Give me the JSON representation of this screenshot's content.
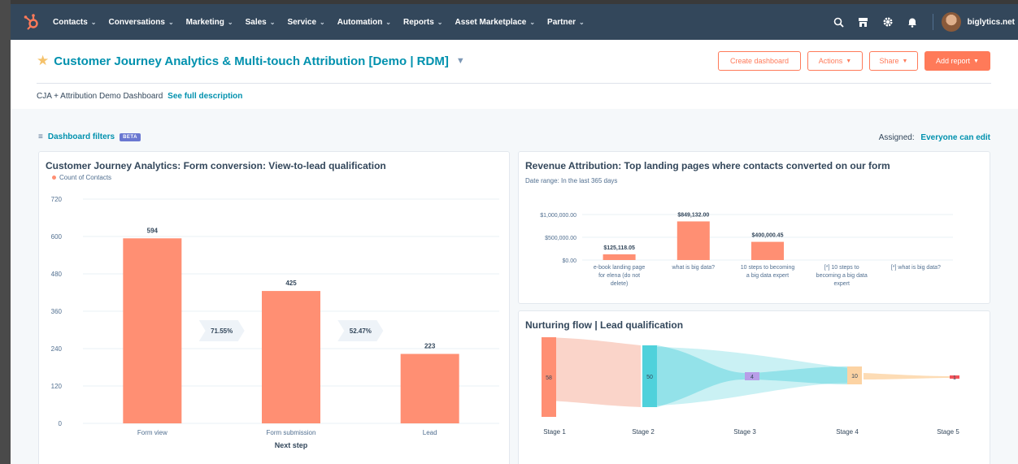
{
  "nav": {
    "items": [
      "Contacts",
      "Conversations",
      "Marketing",
      "Sales",
      "Service",
      "Automation",
      "Reports",
      "Asset Marketplace",
      "Partner"
    ],
    "account": "biglytics.net"
  },
  "header": {
    "title": "Customer Journey Analytics & Multi-touch Attribution [Demo | RDM]",
    "buttons": {
      "create_dashboard": "Create dashboard",
      "actions": "Actions",
      "share": "Share",
      "add_report": "Add report"
    },
    "description": "CJA + Attribution Demo Dashboard",
    "see_full": "See full description"
  },
  "toolbar": {
    "filters_label": "Dashboard filters",
    "beta": "BETA",
    "assigned_label": "Assigned:",
    "assigned_value": "Everyone can edit"
  },
  "colors": {
    "brand_dark": "#33475b",
    "accent": "#ff7a59",
    "link": "#0091ae",
    "bar": "#ff8f73",
    "flow_teal": "#4fd1db",
    "stage_purple": "#b89ee8",
    "stage_peach": "#fcd3a3"
  },
  "chart_data": [
    {
      "type": "bar",
      "title": "Customer Journey Analytics: Form conversion: View-to-lead qualification",
      "legend": [
        "Count of Contacts"
      ],
      "categories": [
        "Form view",
        "Form submission",
        "Lead"
      ],
      "values": [
        594,
        425,
        223
      ],
      "value_labels": [
        "594",
        "425",
        "223"
      ],
      "conversion_rates": [
        "71.55%",
        "52.47%"
      ],
      "xlabel": "Next step",
      "ylabel": "",
      "yticks": [
        "0",
        "120",
        "240",
        "360",
        "480",
        "600",
        "720"
      ],
      "ylim": [
        0,
        720
      ]
    },
    {
      "type": "bar",
      "title": "Revenue Attribution: Top landing pages where contacts converted on our form",
      "subtitle": "Date range: In the last 365 days",
      "categories": [
        [
          "e-book landing page",
          "for elena (do not",
          "delete)"
        ],
        [
          "what is big data?"
        ],
        [
          "10 steps to becoming",
          "a big data expert"
        ],
        [
          "[*] 10 steps to",
          "becoming a big data",
          "expert"
        ],
        [
          "[*] what is big data?"
        ]
      ],
      "values": [
        125118.05,
        849132.0,
        400000.45,
        0,
        0
      ],
      "value_labels": [
        "$125,118.05",
        "$849,132.00",
        "$400,000.45",
        "",
        ""
      ],
      "yticks": [
        "$0.00",
        "$500,000.00",
        "$1,000,000.00"
      ],
      "ylim": [
        0,
        1000000
      ]
    },
    {
      "type": "other",
      "title": "Nurturing flow | Lead qualification",
      "stages": [
        "Stage 1",
        "Stage 2",
        "Stage 3",
        "Stage 4",
        "Stage 5"
      ],
      "counts": [
        "58",
        "50",
        "4",
        "10",
        "1"
      ]
    }
  ]
}
